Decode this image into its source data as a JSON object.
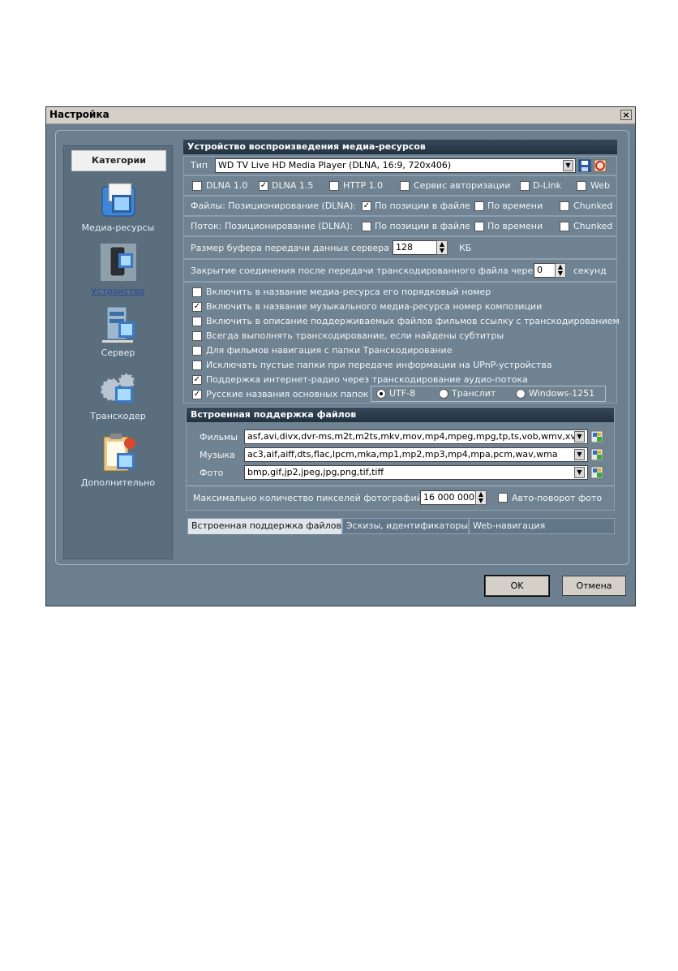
{
  "window": {
    "title": "Настройка"
  },
  "sidebar": {
    "header": "Категории",
    "items": [
      {
        "label": "Медиа-ресурсы",
        "icon": "media-resources-icon"
      },
      {
        "label": "Устройство",
        "icon": "device-icon",
        "selected": true
      },
      {
        "label": "Сервер",
        "icon": "server-icon"
      },
      {
        "label": "Транскодер",
        "icon": "transcoder-icon"
      },
      {
        "label": "Дополнительно",
        "icon": "additional-icon"
      }
    ]
  },
  "device": {
    "section_title": "Устройство воспроизведения медиа-ресурсов",
    "type_label": "Тип",
    "type_value": "WD TV Live HD Media Player (DLNA, 16:9, 720x406)",
    "protocols": [
      {
        "label": "DLNA 1.0",
        "checked": false
      },
      {
        "label": "DLNA 1.5",
        "checked": true
      },
      {
        "label": "HTTP 1.0",
        "checked": false
      },
      {
        "label": "Сервис авторизации",
        "checked": false
      },
      {
        "label": "D-Link",
        "checked": false
      },
      {
        "label": "Web",
        "checked": false
      }
    ],
    "files_label": "Файлы: Позиционирование (DLNA):",
    "files_options": [
      {
        "label": "По позиции в файле",
        "checked": true
      },
      {
        "label": "По времени",
        "checked": false
      },
      {
        "label": "Chunked",
        "checked": false
      }
    ],
    "stream_label": "Поток: Позиционирование (DLNA):",
    "stream_options": [
      {
        "label": "По позиции в файле",
        "checked": false
      },
      {
        "label": "По времени",
        "checked": false
      },
      {
        "label": "Chunked",
        "checked": false
      }
    ],
    "buffer_label": "Размер буфера передачи данных сервера",
    "buffer_value": "128",
    "buffer_unit": "КБ",
    "close_label": "Закрытие соединения после передачи транскодированного файла через",
    "close_value": "0",
    "close_unit": "секунд",
    "options": [
      {
        "label": "Включить в название медиа-ресурса его порядковый номер",
        "checked": false
      },
      {
        "label": "Включить в название музыкального медиа-ресурса номер композиции",
        "checked": true
      },
      {
        "label": "Включить в описание поддерживаемых файлов фильмов ссылку с транскодированием",
        "checked": false
      },
      {
        "label": "Всегда выполнять транскодирование, если найдены субтитры",
        "checked": false
      },
      {
        "label": "Для фильмов навигация с папки Транскодирование",
        "checked": false
      },
      {
        "label": "Исключать пустые папки при передаче информации на  UPnP-устройства",
        "checked": false
      },
      {
        "label": "Поддержка интернет-радио через транскодирование аудио-потока",
        "checked": true
      }
    ],
    "russian_folders": {
      "label": "Русские названия основных папок",
      "checked": true
    },
    "encodings": [
      {
        "label": "UTF-8",
        "selected": true
      },
      {
        "label": "Транслит",
        "selected": false
      },
      {
        "label": "Windows-1251",
        "selected": false
      }
    ]
  },
  "builtin": {
    "section_title": "Встроенная поддержка файлов",
    "movies_label": "Фильмы",
    "movies_value": "asf,avi,divx,dvr-ms,m2t,m2ts,mkv,mov,mp4,mpeg,mpg,tp,ts,vob,wmv,xvid",
    "music_label": "Музыка",
    "music_value": "ac3,aif,aiff,dts,flac,lpcm,mka,mp1,mp2,mp3,mp4,mpa,pcm,wav,wma",
    "photo_label": "Фото",
    "photo_value": "bmp,gif,jp2,jpeg,jpg,png,tif,tiff",
    "max_pixels_label": "Максимально количество пикселей фотографий",
    "max_pixels_value": "16 000 000",
    "autorotate_label": "Авто-поворот фото",
    "autorotate_checked": false
  },
  "tabs": [
    {
      "label": "Встроенная поддержка файлов",
      "active": true
    },
    {
      "label": "Эскизы, идентификаторы",
      "active": false
    },
    {
      "label": "Web-навигация",
      "active": false
    }
  ],
  "buttons": {
    "ok": "OK",
    "cancel": "Отмена"
  }
}
